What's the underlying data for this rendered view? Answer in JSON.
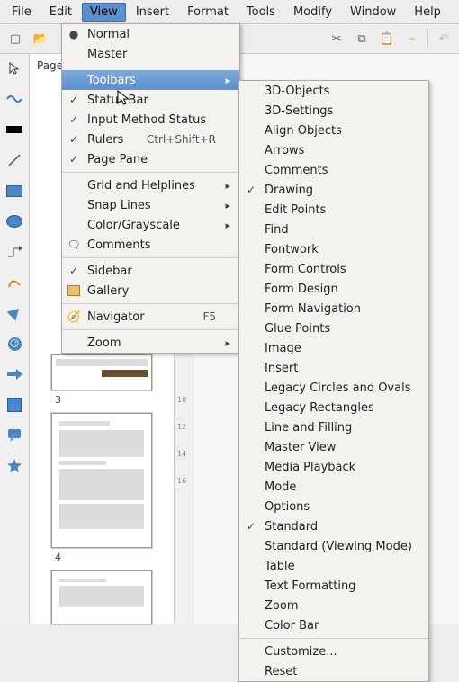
{
  "menubar": [
    "File",
    "Edit",
    "View",
    "Insert",
    "Format",
    "Tools",
    "Modify",
    "Window",
    "Help"
  ],
  "menubar_active_index": 2,
  "view_menu": {
    "groups": [
      [
        {
          "label": "Normal",
          "icon": "radio",
          "checked": true
        },
        {
          "label": "Master",
          "icon": ""
        }
      ],
      [
        {
          "label": "Toolbars",
          "icon": "",
          "submenu": true,
          "highlight": true
        },
        {
          "label": "Status Bar",
          "icon": "check",
          "checked": true
        },
        {
          "label": "Input Method Status",
          "icon": "check",
          "checked": true
        },
        {
          "label": "Rulers",
          "icon": "check",
          "checked": true,
          "accel": "Ctrl+Shift+R"
        },
        {
          "label": "Page Pane",
          "icon": "check",
          "checked": true
        }
      ],
      [
        {
          "label": "Grid and Helplines",
          "submenu": true
        },
        {
          "label": "Snap Lines",
          "submenu": true
        },
        {
          "label": "Color/Grayscale",
          "submenu": true
        },
        {
          "label": "Comments",
          "icon": "comment"
        }
      ],
      [
        {
          "label": "Sidebar",
          "icon": "check",
          "checked": true
        },
        {
          "label": "Gallery",
          "icon": "gallery"
        }
      ],
      [
        {
          "label": "Navigator",
          "icon": "navigator",
          "accel": "F5"
        }
      ],
      [
        {
          "label": "Zoom",
          "submenu": true
        }
      ]
    ]
  },
  "toolbars_menu": {
    "items": [
      {
        "label": "3D-Objects"
      },
      {
        "label": "3D-Settings"
      },
      {
        "label": "Align Objects"
      },
      {
        "label": "Arrows"
      },
      {
        "label": "Comments"
      },
      {
        "label": "Drawing",
        "checked": true
      },
      {
        "label": "Edit Points"
      },
      {
        "label": "Find"
      },
      {
        "label": "Fontwork"
      },
      {
        "label": "Form Controls"
      },
      {
        "label": "Form Design"
      },
      {
        "label": "Form Navigation"
      },
      {
        "label": "Glue Points"
      },
      {
        "label": "Image"
      },
      {
        "label": "Insert"
      },
      {
        "label": "Legacy Circles and Ovals"
      },
      {
        "label": "Legacy Rectangles"
      },
      {
        "label": "Line and Filling"
      },
      {
        "label": "Master View"
      },
      {
        "label": "Media Playback"
      },
      {
        "label": "Mode"
      },
      {
        "label": "Options"
      },
      {
        "label": "Standard",
        "checked": true
      },
      {
        "label": "Standard (Viewing Mode)"
      },
      {
        "label": "Table"
      },
      {
        "label": "Text Formatting"
      },
      {
        "label": "Zoom"
      },
      {
        "label": "Color Bar"
      }
    ],
    "footer": [
      {
        "label": "Customize..."
      },
      {
        "label": "Reset"
      }
    ]
  },
  "panel": {
    "title": "Pages",
    "page_numbers": [
      "3",
      "4"
    ]
  },
  "colors": {
    "highlight": "#5b8fcf"
  }
}
